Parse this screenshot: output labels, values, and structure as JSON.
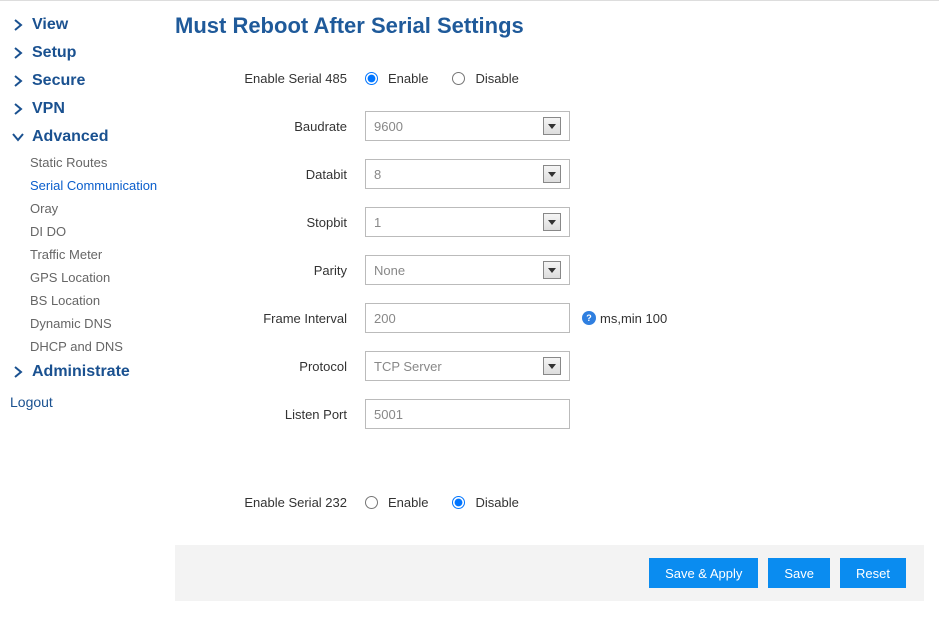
{
  "nav": {
    "groups": [
      {
        "label": "View"
      },
      {
        "label": "Setup"
      },
      {
        "label": "Secure"
      },
      {
        "label": "VPN"
      },
      {
        "label": "Advanced"
      },
      {
        "label": "Administrate"
      }
    ],
    "advanced_items": [
      "Static Routes",
      "Serial Communication",
      "Oray",
      "DI DO",
      "Traffic Meter",
      "GPS Location",
      "BS Location",
      "Dynamic DNS",
      "DHCP and DNS"
    ],
    "logout": "Logout"
  },
  "page": {
    "title": "Must Reboot After Serial Settings",
    "enable485_label": "Enable Serial 485",
    "enable232_label": "Enable Serial 232",
    "option_enable": "Enable",
    "option_disable": "Disable",
    "baudrate_label": "Baudrate",
    "baudrate_value": "9600",
    "databit_label": "Databit",
    "databit_value": "8",
    "stopbit_label": "Stopbit",
    "stopbit_value": "1",
    "parity_label": "Parity",
    "parity_value": "None",
    "frame_label": "Frame Interval",
    "frame_value": "200",
    "frame_hint": "ms,min 100",
    "protocol_label": "Protocol",
    "protocol_value": "TCP Server",
    "listen_label": "Listen Port",
    "listen_value": "5001"
  },
  "footer": {
    "save_apply": "Save & Apply",
    "save": "Save",
    "reset": "Reset"
  }
}
